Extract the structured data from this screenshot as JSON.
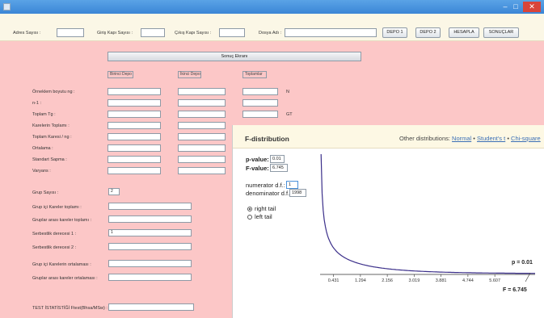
{
  "window": {
    "min": "–",
    "max": "□",
    "close": "✕"
  },
  "toolbar": {
    "adres_label": "Adres Sayısı :",
    "giris_label": "Giriş Kapı Sayısı :",
    "cikis_label": "Çıkış Kapı Sayısı :",
    "dosya_label": "Dosya Adı :",
    "depo1": "DEPO 1",
    "depo2": "DEPO 2",
    "hesapla": "HESAPLA",
    "sonuclar": "SONUÇLAR"
  },
  "results": {
    "section_title": "Sonuç Ekranı",
    "columns": [
      "Birinci Depo",
      "İkinci Depo",
      "Toplamlar"
    ],
    "rows": [
      {
        "label": "Örneklem boyutu ng :",
        "unit": "N"
      },
      {
        "label": "n-1 :",
        "unit": ""
      },
      {
        "label": "Toplam Tg :",
        "unit": "GT"
      },
      {
        "label": "Karelerin Toplamı :",
        "unit": ""
      },
      {
        "label": "Toplam Karesi / ng :",
        "unit": ""
      },
      {
        "label": "Ortalama :",
        "unit": ""
      },
      {
        "label": "Standart Sapma :",
        "unit": ""
      },
      {
        "label": "Varyans :",
        "unit": ""
      }
    ]
  },
  "anova": {
    "grup_label": "Grup Sayısı :",
    "grup_value": "2",
    "grup_ici_label": "Grup içi Kareler toplamı :",
    "gruplar_arasi_label": "Gruplar arası kareler toplamı :",
    "sd1_label": "Serbestlik derecesi 1 :",
    "sd1_value": "1",
    "sd2_label": "Serbestlik derecesi 2 :",
    "grup_ici_ort_label": "Grup içi Karelerin ortalaması :",
    "gruplar_arasi_ort_label": "Gruplar arası kareler ortalaması :",
    "test_label": "TEST İSTATİSTİĞİ Ftest(Bhsa/MSw) :"
  },
  "fdist": {
    "title": "F-distribution",
    "other_label": "Other distributions:",
    "links": [
      "Normal",
      "Student's t",
      "Chi-square"
    ],
    "pvalue_label": "p-value:",
    "pvalue": "0.01",
    "fvalue_label": "F-value:",
    "fvalue": "6.745",
    "num_label": "numerator d.f.:",
    "num_value": "1",
    "den_label": "denominator d.f.:",
    "den_value": "1998",
    "right_tail": "right tail",
    "left_tail": "left tail",
    "selected_tail": "right tail",
    "p_annotation": "p = 0.01",
    "f_annotation": "F = 6.745",
    "ticks": [
      "0.431",
      "1.294",
      "2.156",
      "3.019",
      "3.881",
      "4.744",
      "5.607"
    ]
  },
  "chart_data": {
    "type": "line",
    "series": [
      {
        "df1": 1,
        "df2": 1998
      }
    ],
    "xlim": [
      0,
      6.9
    ],
    "x_ticks": [
      0.431,
      1.294,
      2.156,
      3.019,
      3.881,
      4.744,
      5.607
    ],
    "critical_f": 6.745,
    "p_value": 0.01,
    "tail": "right"
  }
}
